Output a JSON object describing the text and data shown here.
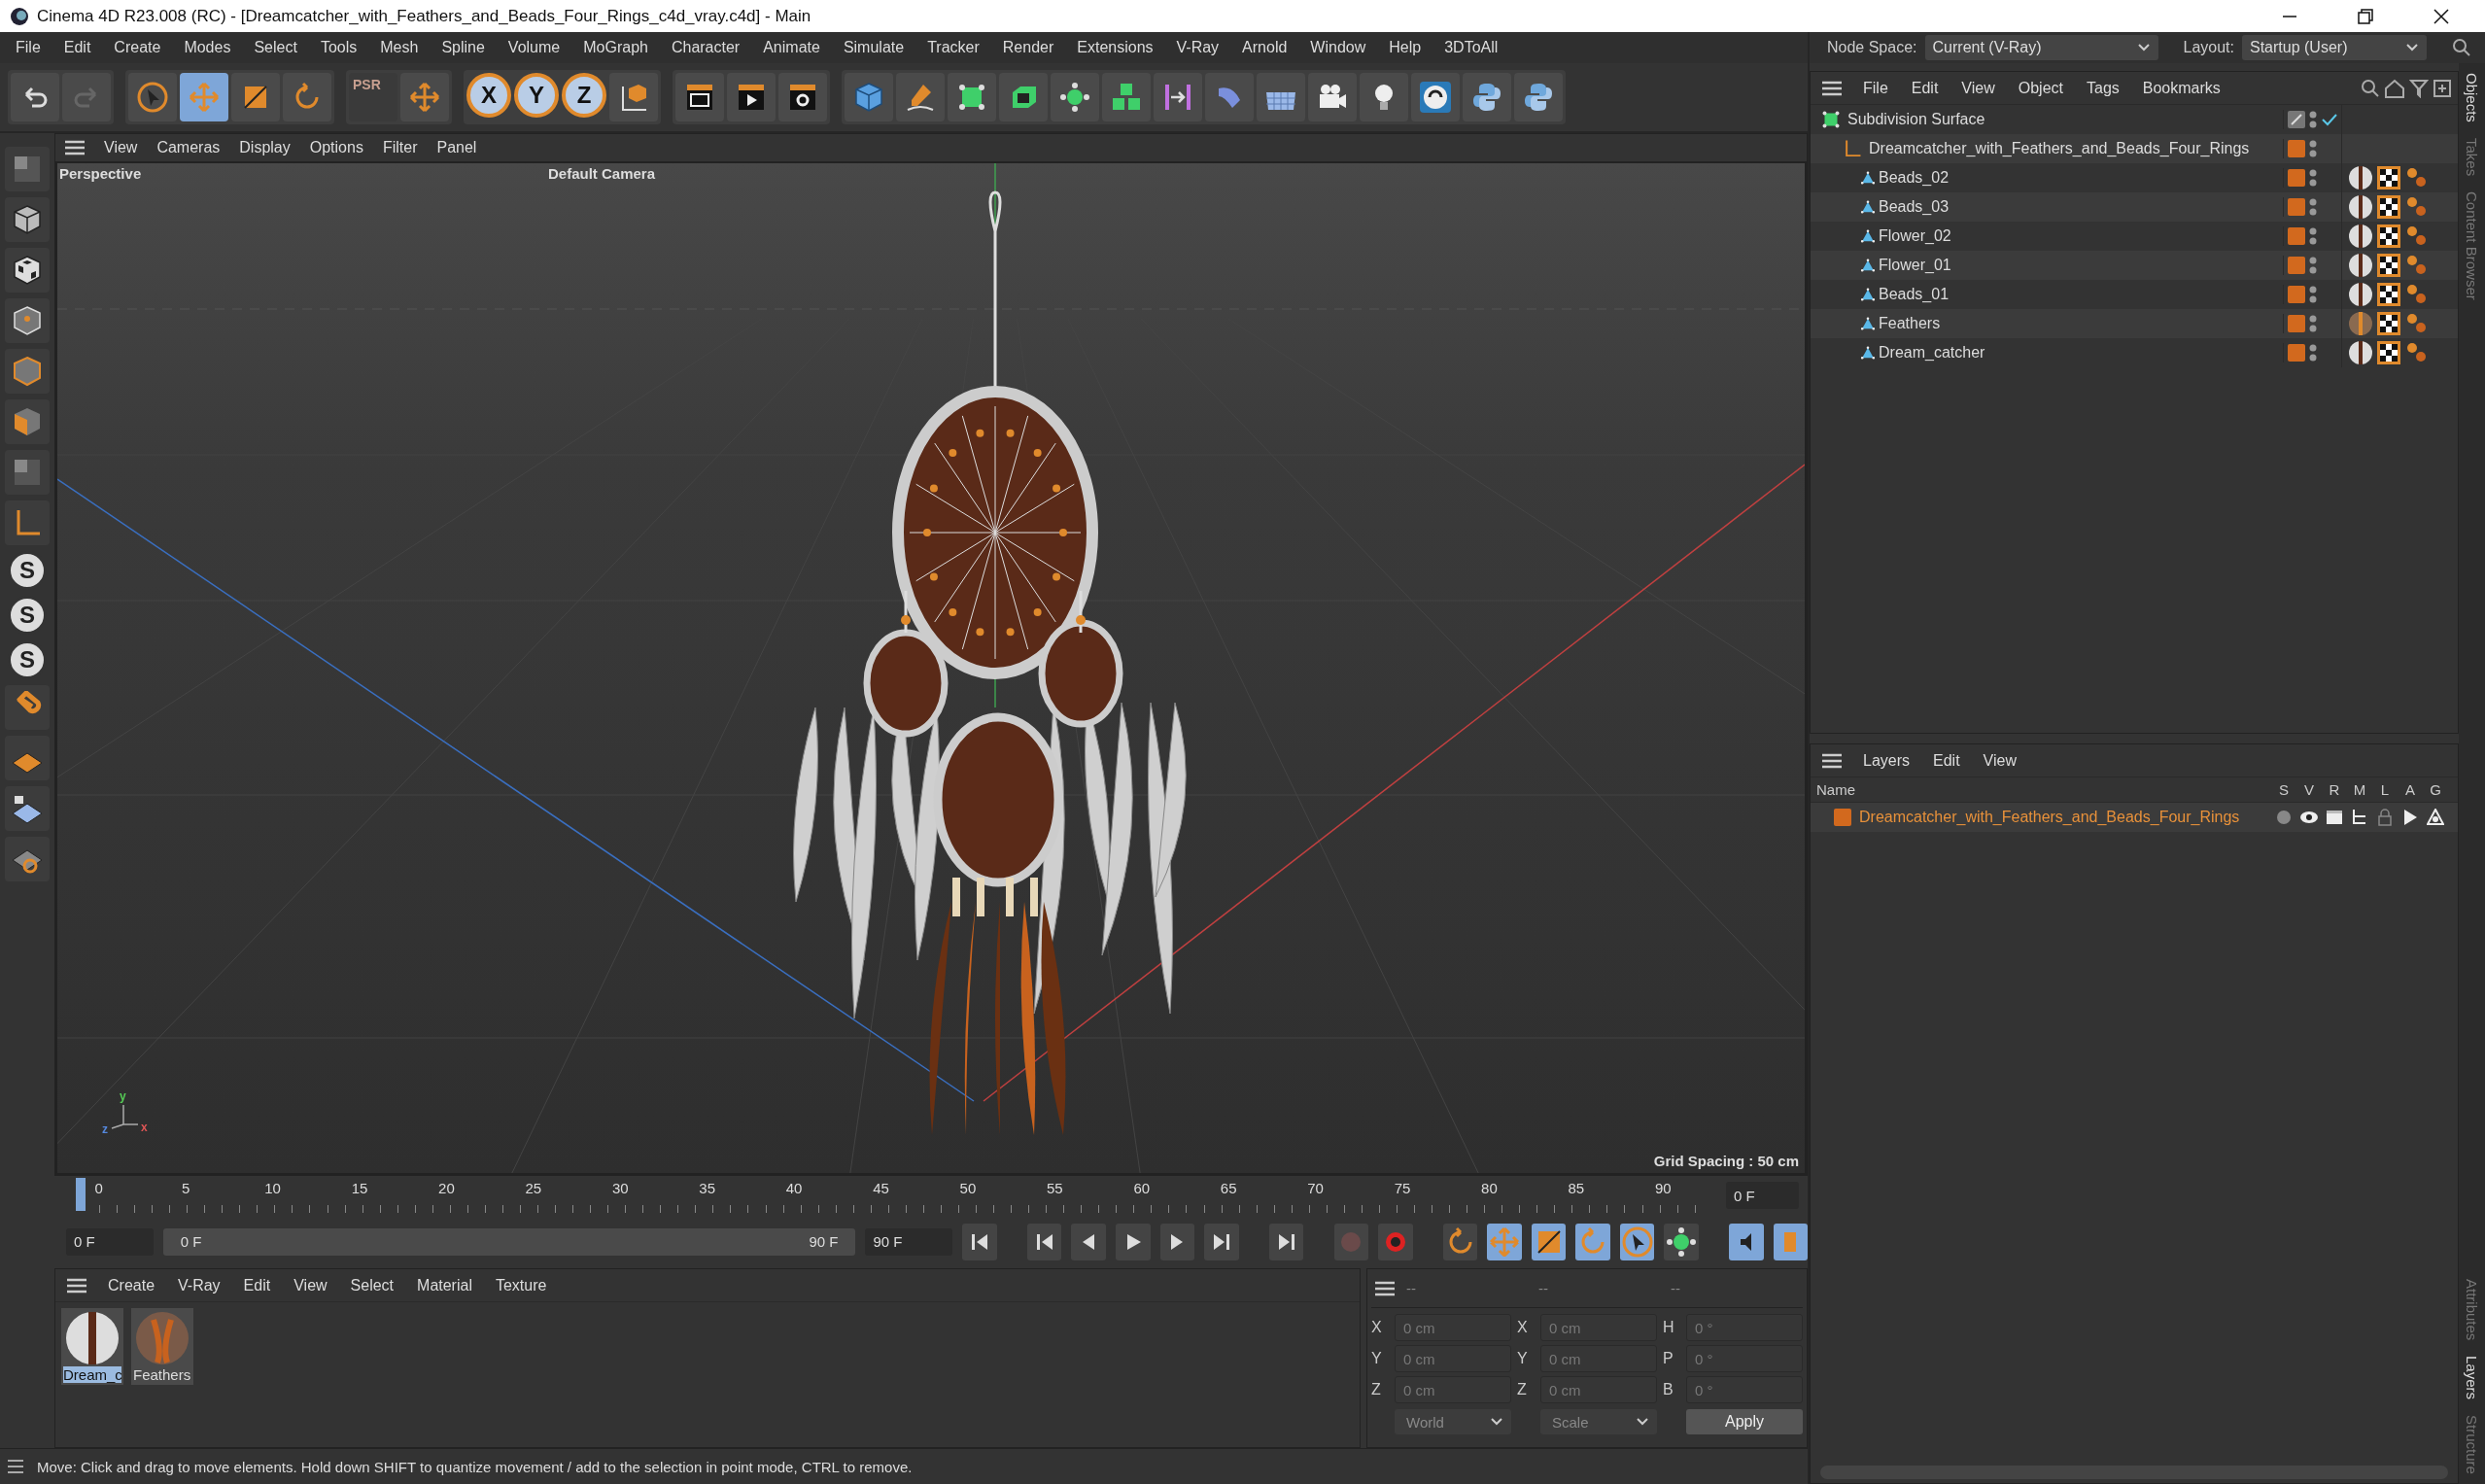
{
  "window": {
    "title": "Cinema 4D R23.008 (RC) - [Dreamcatcher_with_Feathers_and_Beads_Four_Rings_c4d_vray.c4d] - Main"
  },
  "menu": [
    "File",
    "Edit",
    "Create",
    "Modes",
    "Select",
    "Tools",
    "Mesh",
    "Spline",
    "Volume",
    "MoGraph",
    "Character",
    "Animate",
    "Simulate",
    "Tracker",
    "Render",
    "Extensions",
    "V-Ray",
    "Arnold",
    "Window",
    "Help",
    "3DToAll"
  ],
  "node_space": {
    "label": "Node Space:",
    "value": "Current (V-Ray)"
  },
  "layout": {
    "label": "Layout:",
    "value": "Startup (User)"
  },
  "toolbar": {
    "tools": [
      {
        "kind": "select",
        "selected": false
      },
      {
        "kind": "move",
        "selected": true
      },
      {
        "kind": "scale",
        "selected": false
      },
      {
        "kind": "rotate",
        "selected": false
      }
    ],
    "psr": "PSR",
    "axes": [
      {
        "label": "X",
        "on": true
      },
      {
        "label": "Y",
        "on": true
      },
      {
        "label": "Z",
        "on": true
      }
    ]
  },
  "left_toolbar": {
    "letters": [
      "S",
      "S",
      "S"
    ]
  },
  "viewport": {
    "menu": [
      "View",
      "Cameras",
      "Display",
      "Options",
      "Filter",
      "Panel"
    ],
    "label": "Perspective",
    "camera": "Default Camera",
    "grid_spacing": "Grid Spacing : 50 cm",
    "axis_labels": [
      "y",
      "z",
      "x"
    ]
  },
  "timeline": {
    "ticks": [
      "0",
      "5",
      "10",
      "15",
      "20",
      "25",
      "30",
      "35",
      "40",
      "45",
      "50",
      "55",
      "60",
      "65",
      "70",
      "75",
      "80",
      "85",
      "90"
    ],
    "current": "0 F",
    "start": "0 F",
    "range_start": "0 F",
    "range_end": "90 F",
    "end": "90 F"
  },
  "objects": {
    "menu": [
      "File",
      "Edit",
      "View",
      "Object",
      "Tags",
      "Bookmarks"
    ],
    "tree": [
      {
        "name": "Subdivision Surface",
        "kind": "subdivision",
        "enabled": true,
        "children": [
          {
            "name": "Dreamcatcher_with_Feathers_and_Beads_Four_Rings",
            "kind": "null",
            "children": [
              {
                "name": "Beads_02",
                "kind": "polygon",
                "tag": {
                  "kind": "plain"
                }
              },
              {
                "name": "Beads_03",
                "kind": "polygon",
                "tag": {
                  "kind": "plain"
                }
              },
              {
                "name": "Flower_02",
                "kind": "polygon",
                "tag": {
                  "kind": "plain"
                }
              },
              {
                "name": "Flower_01",
                "kind": "polygon",
                "tag": {
                  "kind": "plain"
                }
              },
              {
                "name": "Beads_01",
                "kind": "polygon",
                "tag": {
                  "kind": "plain"
                }
              },
              {
                "name": "Feathers",
                "kind": "polygon",
                "tag": {
                  "kind": "feathers"
                }
              },
              {
                "name": "Dream_catcher",
                "kind": "polygon",
                "tag": {
                  "kind": "plain"
                }
              }
            ]
          }
        ]
      }
    ]
  },
  "layers": {
    "menu": [
      "Layers",
      "Edit",
      "View"
    ],
    "columns": [
      "Name",
      "S",
      "V",
      "R",
      "M",
      "L",
      "A",
      "G"
    ],
    "rows": [
      {
        "name": "Dreamcatcher_with_Feathers_and_Beads_Four_Rings"
      }
    ]
  },
  "side_tabs_top": [
    {
      "label": "Objects",
      "selected": true
    },
    {
      "label": "Takes",
      "selected": false
    },
    {
      "label": "Content Browser",
      "selected": false
    }
  ],
  "side_tabs_bottom": [
    {
      "label": "Attributes",
      "selected": false
    },
    {
      "label": "Layers",
      "selected": true
    },
    {
      "label": "Structure",
      "selected": false
    }
  ],
  "materials": {
    "menu": [
      "Create",
      "V-Ray",
      "Edit",
      "View",
      "Select",
      "Material",
      "Texture"
    ],
    "items": [
      {
        "name": "Dream_c",
        "kind": "plain",
        "selected": true
      },
      {
        "name": "Feathers",
        "kind": "feathers",
        "selected": false
      }
    ]
  },
  "coordinates": {
    "headers": [
      "--",
      "--",
      "--"
    ],
    "rows": [
      {
        "a": "X",
        "pos": "0 cm",
        "b": "X",
        "size": "0 cm",
        "c": "H",
        "rot": "0 °"
      },
      {
        "a": "Y",
        "pos": "0 cm",
        "b": "Y",
        "size": "0 cm",
        "c": "P",
        "rot": "0 °"
      },
      {
        "a": "Z",
        "pos": "0 cm",
        "b": "Z",
        "size": "0 cm",
        "c": "B",
        "rot": "0 °"
      }
    ],
    "mode": "World",
    "scale": "Scale",
    "apply": "Apply"
  },
  "status_bar": "Move: Click and drag to move elements. Hold down SHIFT to quantize movement / add to the selection in point mode, CTRL to remove."
}
